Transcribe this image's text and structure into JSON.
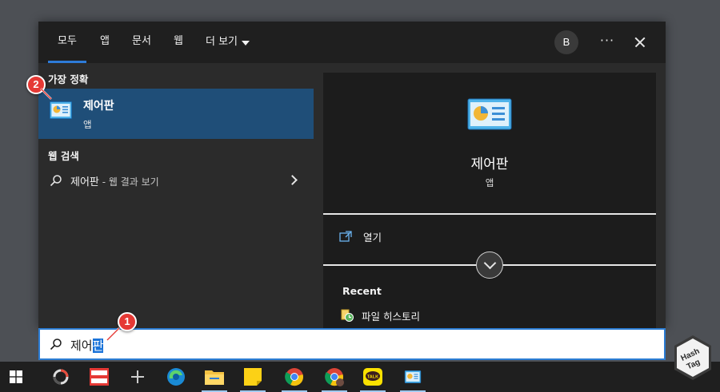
{
  "tabs": [
    {
      "label": "모두",
      "active": true
    },
    {
      "label": "앱"
    },
    {
      "label": "문서"
    },
    {
      "label": "웹"
    },
    {
      "label": "더 보기"
    }
  ],
  "header": {
    "avatar_initial": "B",
    "more_label": "···"
  },
  "left": {
    "best_match_heading": "가장 정확",
    "best_match": {
      "title": "제어판",
      "subtitle": "앱",
      "icon": "control-panel-icon"
    },
    "web_heading": "웹 검색",
    "web_result": {
      "query": "제어판",
      "suffix": " - 웹 결과 보기"
    }
  },
  "right": {
    "title": "제어판",
    "subtitle": "앱",
    "open_label": "열기",
    "recent_heading": "Recent",
    "recent_items": [
      {
        "label": "파일 히스토리",
        "icon": "file-history-icon"
      }
    ]
  },
  "search": {
    "typed": "제어",
    "selected": "판"
  },
  "badges": {
    "step1": "1",
    "step2": "2"
  },
  "taskbar_items": [
    "windows-start-icon",
    "app-ring-icon",
    "app-red-icon",
    "plus-icon",
    "edge-icon",
    "file-explorer-icon",
    "sticky-notes-icon",
    "chrome-icon",
    "chrome-profile-icon",
    "kakaotalk-icon",
    "control-panel-icon"
  ],
  "logo": {
    "line1": "Hash",
    "line2": "Tag"
  },
  "colors": {
    "accent": "#2d7bd8",
    "selection": "#1f4e78",
    "badge": "#e53935"
  }
}
